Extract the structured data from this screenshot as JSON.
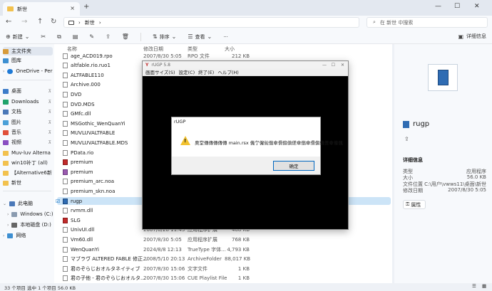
{
  "tab": {
    "title": "新世",
    "close": "×",
    "new": "+"
  },
  "window_controls": {
    "min": "—",
    "max": "☐",
    "close": "✕"
  },
  "address": {
    "crumb1": "›",
    "folder": "新世",
    "crumb2": "›",
    "search_placeholder": "在 新世 中搜索"
  },
  "toolbar": {
    "new": "新建",
    "sort": "排序",
    "view": "查看",
    "more": "···",
    "details": "详细信息"
  },
  "sidebar": [
    {
      "label": "主文件夹",
      "icon": "home-icon"
    },
    {
      "label": "图库",
      "icon": "gallery-icon"
    },
    {
      "label": "OneDrive - Pers",
      "icon": "cloud-icon"
    },
    {
      "label": "桌面",
      "icon": "desktop-icon"
    },
    {
      "label": "Downloads",
      "icon": "download-icon"
    },
    {
      "label": "文档",
      "icon": "document-icon"
    },
    {
      "label": "图片",
      "icon": "picture-icon"
    },
    {
      "label": "音乐",
      "icon": "music-icon"
    },
    {
      "label": "视频",
      "icon": "video-icon"
    },
    {
      "label": "Muv-luv Alterna",
      "icon": "folder-icon"
    },
    {
      "label": "win10补丁 (all)",
      "icon": "folder-icon"
    },
    {
      "label": "【Alternative6新",
      "icon": "folder-icon"
    },
    {
      "label": "新世",
      "icon": "folder-icon"
    },
    {
      "label": "此电脑",
      "icon": "pc-icon"
    },
    {
      "label": "Windows (C:)",
      "icon": "drive-icon"
    },
    {
      "label": "本地磁盘 (D:)",
      "icon": "drive-icon"
    },
    {
      "label": "网络",
      "icon": "network-icon"
    }
  ],
  "columns": {
    "name": "名称",
    "date": "修改日期",
    "type": "类型",
    "size": "大小"
  },
  "files": [
    {
      "name": "age_ACD019.rpo",
      "date": "2007/8/30 5:05",
      "type": "RPO 文件",
      "size": "212 KB",
      "kind": "file"
    },
    {
      "name": "altfable.rio.ruo1",
      "date": "2",
      "type": "",
      "size": "",
      "kind": "file"
    },
    {
      "name": "ALTFABLE110",
      "date": "2",
      "type": "",
      "size": "",
      "kind": "file"
    },
    {
      "name": "Archive.000",
      "date": "2",
      "type": "",
      "size": "",
      "kind": "file"
    },
    {
      "name": "DVD",
      "date": "2",
      "type": "",
      "size": "",
      "kind": "file"
    },
    {
      "name": "DVD.MDS",
      "date": "2",
      "type": "",
      "size": "",
      "kind": "file"
    },
    {
      "name": "GMfc.dll",
      "date": "2",
      "type": "",
      "size": "",
      "kind": "file"
    },
    {
      "name": "MSGothic_WenQuanYi",
      "date": "2",
      "type": "",
      "size": "",
      "kind": "file"
    },
    {
      "name": "MUVLUVALTFABLE",
      "date": "2",
      "type": "",
      "size": "",
      "kind": "file"
    },
    {
      "name": "MUVLUVALTFABLE.MDS",
      "date": "2",
      "type": "",
      "size": "",
      "kind": "file"
    },
    {
      "name": "PData.rio",
      "date": "2",
      "type": "",
      "size": "",
      "kind": "file"
    },
    {
      "name": "premium",
      "date": "2",
      "type": "",
      "size": "",
      "kind": "red"
    },
    {
      "name": "premium",
      "date": "2",
      "type": "",
      "size": "",
      "kind": "purple"
    },
    {
      "name": "premium_arc.noa",
      "date": "2",
      "type": "",
      "size": "",
      "kind": "file"
    },
    {
      "name": "premium_skn.noa",
      "date": "2",
      "type": "",
      "size": "",
      "kind": "file"
    },
    {
      "name": "rugp",
      "date": "2",
      "type": "",
      "size": "",
      "kind": "blue"
    },
    {
      "name": "rvmm.dll",
      "date": "2",
      "type": "",
      "size": "",
      "kind": "file"
    },
    {
      "name": "SLG",
      "date": "2",
      "type": "",
      "size": "",
      "kind": "red"
    },
    {
      "name": "UnivUI.dll",
      "date": "2007/8/28 11:45",
      "type": "应用程序扩展",
      "size": "408 KB",
      "kind": "file"
    },
    {
      "name": "Vm60.dll",
      "date": "2007/8/30 5:05",
      "type": "应用程序扩展",
      "size": "768 KB",
      "kind": "file"
    },
    {
      "name": "WenQuanYi",
      "date": "2024/8/8 12:13",
      "type": "TrueType 字体...",
      "size": "4,793 KB",
      "kind": "file"
    },
    {
      "name": "マブラヴ ALTERED FABLE 修正...",
      "date": "2008/5/10 20:13",
      "type": "ArchiveFolder",
      "size": "88,017 KB",
      "kind": "file"
    },
    {
      "name": "君のぞらじおオルタネイティブ",
      "date": "2007/8/30 15:06",
      "type": "文字文件",
      "size": "1 KB",
      "kind": "file"
    },
    {
      "name": "君の子他 - 君のぞらじおオルタ...",
      "date": "2007/8/30 15:06",
      "type": "CUE Playlist File",
      "size": "1 KB",
      "kind": "file"
    }
  ],
  "details": {
    "name": "rugp",
    "props": "详细信息",
    "type_label": "类型",
    "type_value": "应用程序",
    "size_label": "大小",
    "size_value": "56.0 KB",
    "loc_label": "文件位置",
    "loc_value": "C:\\用户\\vwws11\\桌面\\新世",
    "date_label": "修改日期",
    "date_value": "2007/8/30 5:05",
    "attr": "属性"
  },
  "status": {
    "count": "33 个项目",
    "selected": "选中 1 个项目 56.0 KB"
  },
  "rugp_window": {
    "title": "rUGP 5.8",
    "menu": [
      "画面サイズ(S)",
      "設定(C)",
      "終了(E)",
      "ヘルプ(H)"
    ]
  },
  "dialog": {
    "title": "rUGP",
    "message": "奥堂傳傳傳傳傳 main.rsx 僟亇僱傡傟傘傦傓傎傞傘傟傘傦傓傎傞傘傕偑",
    "ok": "确定"
  }
}
